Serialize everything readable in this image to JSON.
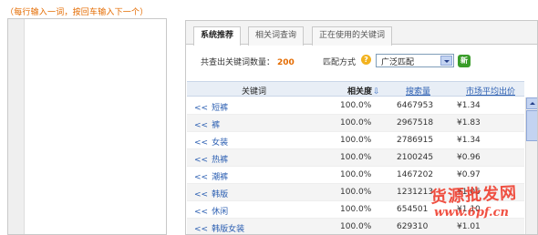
{
  "hint": "（每行输入一词，按回车输入下一个）",
  "tabs": [
    {
      "label": "系统推荐",
      "active": true
    },
    {
      "label": "相关词查询",
      "active": false
    },
    {
      "label": "正在使用的关键词",
      "active": false
    }
  ],
  "stats": {
    "label": "共查出关键词数量：",
    "count": "200"
  },
  "match": {
    "label": "匹配方式",
    "help_icon": "question-icon",
    "selected": "广泛匹配",
    "go_icon": "go-icon",
    "go_text": "新"
  },
  "table": {
    "headers": {
      "keyword": "关键词",
      "relevance": "相关度",
      "sort_icon": "⇩",
      "search": "搜索量",
      "price": "市场平均出价"
    },
    "chevron": "<<",
    "rows": [
      {
        "keyword": "短裤",
        "relevance": "100.0%",
        "search": "6467953",
        "price": "¥1.34"
      },
      {
        "keyword": "裤",
        "relevance": "100.0%",
        "search": "2967518",
        "price": "¥1.83"
      },
      {
        "keyword": "女装",
        "relevance": "100.0%",
        "search": "2786915",
        "price": "¥1.34"
      },
      {
        "keyword": "热裤",
        "relevance": "100.0%",
        "search": "2100245",
        "price": "¥0.96"
      },
      {
        "keyword": "潮裤",
        "relevance": "100.0%",
        "search": "1467202",
        "price": "¥0.97"
      },
      {
        "keyword": "韩版",
        "relevance": "100.0%",
        "search": "1231213",
        "price": "¥1.06"
      },
      {
        "keyword": "休闲",
        "relevance": "100.0%",
        "search": "654501",
        "price": "¥1.10"
      },
      {
        "keyword": "韩版女装",
        "relevance": "100.0%",
        "search": "629310",
        "price": "¥1.01"
      }
    ]
  },
  "watermark": {
    "text": "货源批发网",
    "url": "www.6pf.cn"
  },
  "colors": {
    "accent": "#e46b00",
    "link": "#2c5fb2",
    "header_bg": "#e8eef6",
    "watermark": "#ef3e2e"
  }
}
